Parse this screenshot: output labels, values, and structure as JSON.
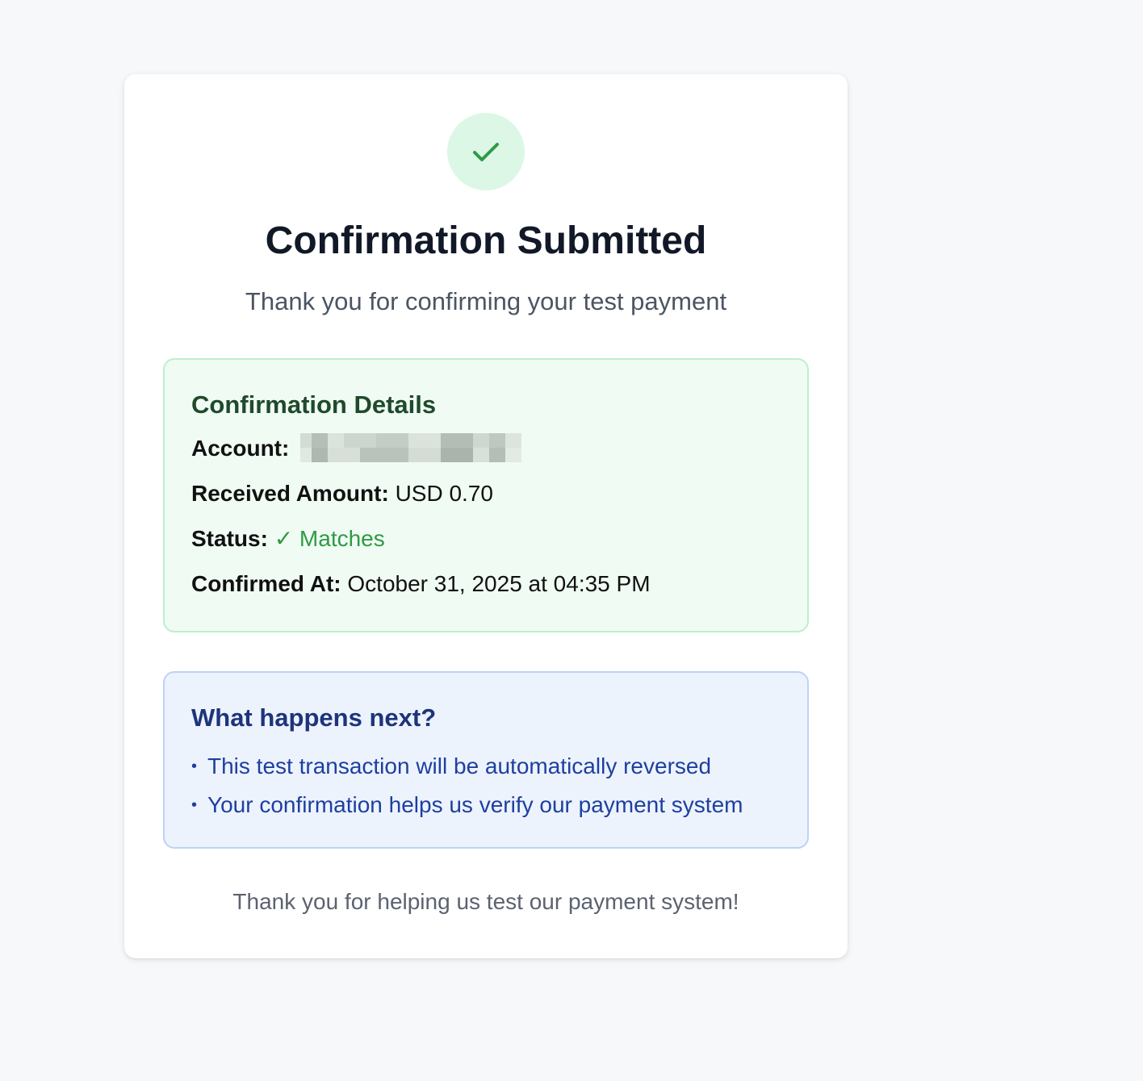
{
  "header": {
    "icon": "checkmark-icon",
    "title": "Confirmation Submitted",
    "subtitle": "Thank you for confirming your test payment"
  },
  "details": {
    "heading": "Confirmation Details",
    "account_label": "Account:",
    "received_amount_label": "Received Amount:",
    "received_amount_value": "USD 0.70",
    "status_label": "Status:",
    "status_value": "✓ Matches",
    "confirmed_at_label": "Confirmed At:",
    "confirmed_at_value": "October 31, 2025 at 04:35 PM"
  },
  "next_steps": {
    "heading": "What happens next?",
    "bullet": "•",
    "items": [
      "This test transaction will be automatically reversed",
      "Your confirmation helps us verify our payment system"
    ]
  },
  "footer": {
    "text": "Thank you for helping us test our payment system!"
  },
  "colors": {
    "page_background": "#f7f8fa",
    "success_circle": "#dcf7e6",
    "success_green": "#2f9a45",
    "details_background": "#f0fbf3",
    "next_background": "#edf3fd",
    "next_text": "#1e3fa0"
  }
}
